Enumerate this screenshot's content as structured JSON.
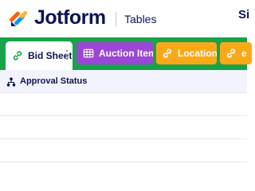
{
  "header": {
    "brand": "Jotform",
    "product": "Tables",
    "cut_text": "Si"
  },
  "tabs": [
    {
      "label": "Bid Sheet",
      "icon": "link-icon",
      "color": "#ffffff",
      "active": true
    },
    {
      "label": "Auction Items",
      "icon": "grid-icon",
      "color": "#9b46d4",
      "active": false
    },
    {
      "label": "Locations",
      "icon": "link-icon",
      "color": "#f9a918",
      "active": false
    },
    {
      "label": "e",
      "icon": "link-icon",
      "color": "#f9a918",
      "active": false
    }
  ],
  "tabbar_color": "#18a34a",
  "table": {
    "column_header": "Approval Status",
    "column_icon": "hierarchy-icon",
    "rows": [
      {},
      {},
      {}
    ]
  }
}
